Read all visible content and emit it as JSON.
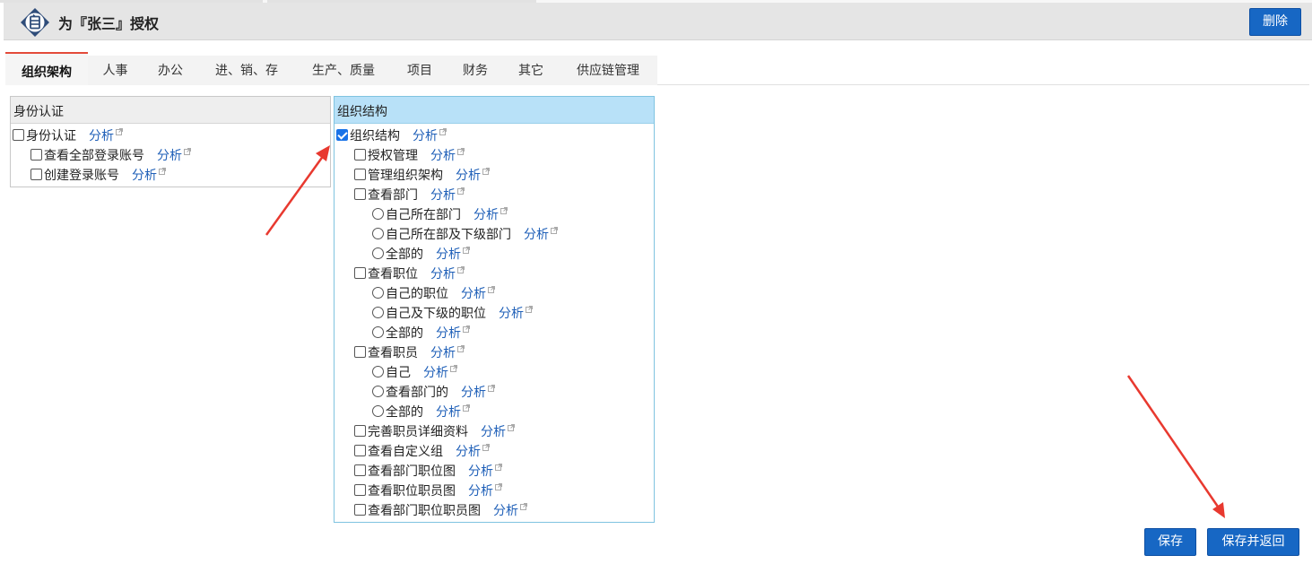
{
  "header": {
    "title": "为『张三』授权",
    "delete_label": "删除"
  },
  "tabs": [
    {
      "label": "组织架构",
      "active": true
    },
    {
      "label": "人事"
    },
    {
      "label": "办公"
    },
    {
      "label": "进、销、存"
    },
    {
      "label": "生产、质量"
    },
    {
      "label": "项目"
    },
    {
      "label": "财务"
    },
    {
      "label": "其它"
    },
    {
      "label": "供应链管理"
    }
  ],
  "analyze_label": "分析",
  "panels": {
    "identity": {
      "title": "身份认证",
      "items": [
        {
          "label": "身份认证",
          "type": "checkbox",
          "level": 0,
          "checked": false
        },
        {
          "label": "查看全部登录账号",
          "type": "checkbox",
          "level": 1,
          "checked": false
        },
        {
          "label": "创建登录账号",
          "type": "checkbox",
          "level": 1,
          "checked": false
        }
      ]
    },
    "org": {
      "title": "组织结构",
      "items": [
        {
          "label": "组织结构",
          "type": "checkbox",
          "level": 0,
          "checked": true
        },
        {
          "label": "授权管理",
          "type": "checkbox",
          "level": 1,
          "checked": false
        },
        {
          "label": "管理组织架构",
          "type": "checkbox",
          "level": 1,
          "checked": false
        },
        {
          "label": "查看部门",
          "type": "checkbox",
          "level": 1,
          "checked": false
        },
        {
          "label": "自己所在部门",
          "type": "radio",
          "level": 2
        },
        {
          "label": "自己所在部及下级部门",
          "type": "radio",
          "level": 2
        },
        {
          "label": "全部的",
          "type": "radio",
          "level": 2
        },
        {
          "label": "查看职位",
          "type": "checkbox",
          "level": 1,
          "checked": false
        },
        {
          "label": "自己的职位",
          "type": "radio",
          "level": 2
        },
        {
          "label": "自己及下级的职位",
          "type": "radio",
          "level": 2
        },
        {
          "label": "全部的",
          "type": "radio",
          "level": 2
        },
        {
          "label": "查看职员",
          "type": "checkbox",
          "level": 1,
          "checked": false
        },
        {
          "label": "自己",
          "type": "radio",
          "level": 2
        },
        {
          "label": "查看部门的",
          "type": "radio",
          "level": 2
        },
        {
          "label": "全部的",
          "type": "radio",
          "level": 2
        },
        {
          "label": "完善职员详细资料",
          "type": "checkbox",
          "level": 1,
          "checked": false
        },
        {
          "label": "查看自定义组",
          "type": "checkbox",
          "level": 1,
          "checked": false
        },
        {
          "label": "查看部门职位图",
          "type": "checkbox",
          "level": 1,
          "checked": false
        },
        {
          "label": "查看职位职员图",
          "type": "checkbox",
          "level": 1,
          "checked": false
        },
        {
          "label": "查看部门职位职员图",
          "type": "checkbox",
          "level": 1,
          "checked": false
        }
      ]
    }
  },
  "footer": {
    "save_label": "保存",
    "save_return_label": "保存并返回"
  },
  "colors": {
    "primary_button": "#1767c4",
    "active_tab_accent": "#e34b3a",
    "link": "#2060b8",
    "panel_highlight": "#b8e1f8",
    "annotation_arrow": "#e8392f"
  }
}
